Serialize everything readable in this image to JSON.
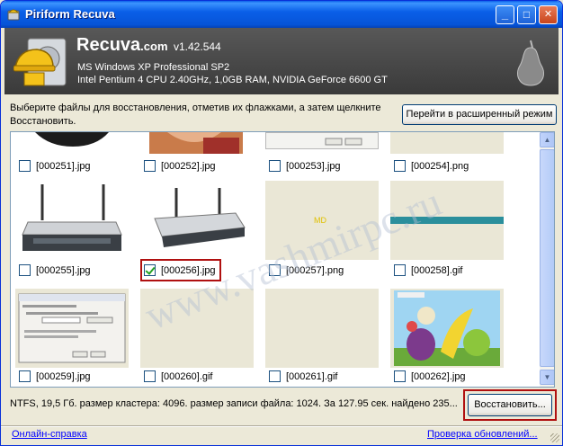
{
  "window": {
    "title": "Piriform Recuva",
    "controls": {
      "minimize": "_",
      "maximize": "□",
      "close": "✕"
    }
  },
  "header": {
    "app_name": "Recuva",
    "app_domain": ".com",
    "version": "v1.42.544",
    "os_line": "MS Windows XP Professional SP2",
    "hw_line": "Intel Pentium 4 CPU 2.40GHz, 1,0GB RAM, NVIDIA GeForce 6600 GT",
    "logo_icon": "hard-drive-helmet-icon",
    "brand_icon": "piriform-pear-icon"
  },
  "instruction": "Выберите файлы для восстановления, отметив их флажками, а затем щелкните Восстановить.",
  "advanced_button": "Перейти в расширенный режим",
  "files": [
    {
      "name": "[000251].jpg",
      "checked": false,
      "thumb": "dark-photo"
    },
    {
      "name": "[000252].jpg",
      "checked": false,
      "thumb": "portrait-photo"
    },
    {
      "name": "[000253].jpg",
      "checked": false,
      "thumb": "dialog-screenshot"
    },
    {
      "name": "[000254].png",
      "checked": false,
      "thumb": "blank"
    },
    {
      "name": "[000255].jpg",
      "checked": false,
      "thumb": "router-photo"
    },
    {
      "name": "[000256].jpg",
      "checked": true,
      "thumb": "router-photo"
    },
    {
      "name": "[000257].png",
      "checked": false,
      "thumb": "md-image"
    },
    {
      "name": "[000258].gif",
      "checked": false,
      "thumb": "teal-bar"
    },
    {
      "name": "[000259].jpg",
      "checked": false,
      "thumb": "settings-dialog"
    },
    {
      "name": "[000260].gif",
      "checked": false,
      "thumb": "blank"
    },
    {
      "name": "[000261].gif",
      "checked": false,
      "thumb": "blank"
    },
    {
      "name": "[000262].jpg",
      "checked": false,
      "thumb": "fruit-illustration"
    }
  ],
  "thumb_texts": {
    "md_label": "MD"
  },
  "status": "NTFS, 19,5 Гб. размер кластера: 4096. размер записи файла: 1024. За 127.95 сек. найдено 235...",
  "recover_button": "Восстановить...",
  "footer": {
    "help_link": "Онлайн-справка",
    "update_link": "Проверка обновлений..."
  },
  "watermark": "www.vashmirpc.ru",
  "colors": {
    "highlight": "#b01010",
    "link": "#0000ff",
    "titlebar": "#0a5fe8"
  }
}
